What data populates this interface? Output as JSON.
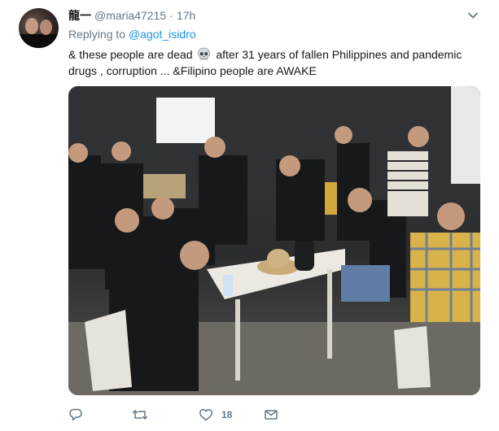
{
  "tweet": {
    "display_name": "龍一",
    "handle": "@maria47215",
    "separator": "·",
    "time": "17h",
    "replying_label": "Replying to",
    "replying_to": "@agot_isidro",
    "text_line1_a": "& these people are dead",
    "text_line1_b": "after 31 years of fallen Philippines and pandemic",
    "text_line2": "drugs , corruption ... &Filipino people are AWAKE",
    "emoji": "skull-emoji",
    "media": "photo-icon"
  },
  "actions": {
    "reply_icon": "reply-icon",
    "retweet_icon": "retweet-icon",
    "like_icon": "heart-icon",
    "like_count": "18",
    "message_icon": "envelope-icon"
  },
  "colors": {
    "text": "#14171a",
    "secondary": "#657786",
    "link": "#1b95e0",
    "icon": "#657786"
  }
}
